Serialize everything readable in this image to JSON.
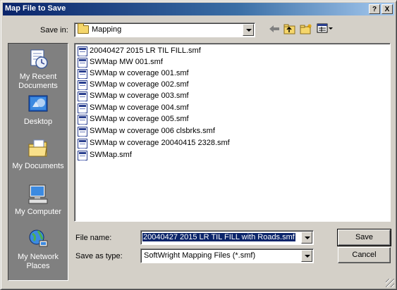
{
  "window": {
    "title": "Map File to Save",
    "help_label": "?",
    "close_label": "X"
  },
  "save_in": {
    "label": "Save in:",
    "value": "Mapping",
    "icon": "folder-icon"
  },
  "toolbar": {
    "back_icon": "back-arrow-icon",
    "up_icon": "up-folder-icon",
    "new_folder_icon": "new-folder-icon",
    "views_icon": "views-menu-icon"
  },
  "places": [
    {
      "label": "My Recent Documents",
      "icon": "recent-documents-icon"
    },
    {
      "label": "Desktop",
      "icon": "desktop-icon"
    },
    {
      "label": "My Documents",
      "icon": "my-documents-icon"
    },
    {
      "label": "My Computer",
      "icon": "my-computer-icon"
    },
    {
      "label": "My Network Places",
      "icon": "network-places-icon"
    }
  ],
  "files": [
    "20040427 2015 LR TIL FILL.smf",
    "SWMap MW 001.smf",
    "SWMap w coverage 001.smf",
    "SWMap w coverage 002.smf",
    "SWMap w coverage 003.smf",
    "SWMap w coverage 004.smf",
    "SWMap w coverage 005.smf",
    "SWMap w coverage 006 clsbrks.smf",
    "SWMap w coverage 20040415 2328.smf",
    "SWMap.smf"
  ],
  "file_name": {
    "label": "File name:",
    "value": "20040427 2015 LR TIL FILL with Roads.smf"
  },
  "save_as_type": {
    "label": "Save as type:",
    "value": "SoftWright Mapping Files (*.smf)"
  },
  "buttons": {
    "save": "Save",
    "cancel": "Cancel"
  }
}
